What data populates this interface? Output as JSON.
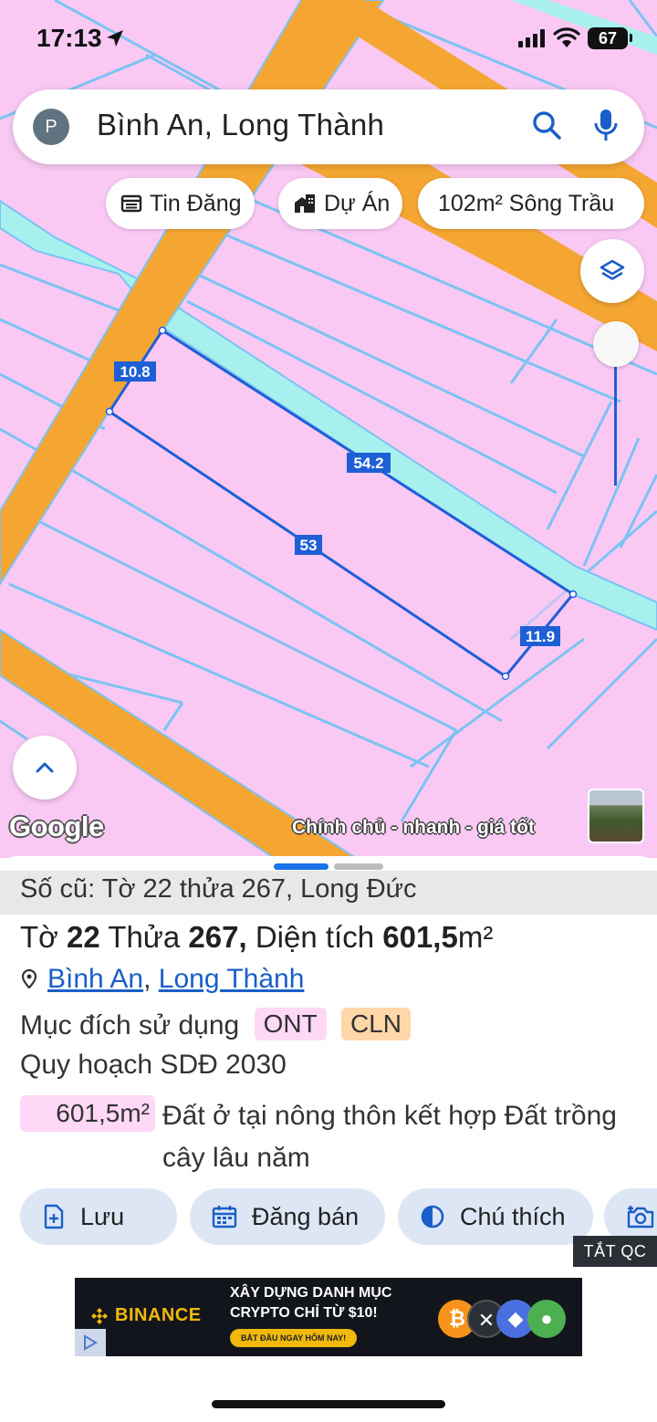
{
  "status_bar": {
    "time": "17:13",
    "battery": "67"
  },
  "search": {
    "avatar_letter": "P",
    "query": "Bình An, Long Thành"
  },
  "chips": [
    {
      "label": "Tin Đăng",
      "icon": "listing-icon"
    },
    {
      "label": "Dự Án",
      "icon": "building-icon"
    },
    {
      "label": "102m² Sông Trầu",
      "icon": ""
    }
  ],
  "map": {
    "edge_labels": {
      "top": "10.8",
      "right_top": "54.2",
      "bottom_long": "53",
      "right": "11.9"
    },
    "google_logo": "Google",
    "promo_text": "Chính chủ - nhanh - giá tốt"
  },
  "colors": {
    "land": "#f9c9f4",
    "road": "#f5a632",
    "water": "#a7f0ee",
    "parcel_line": "#7cc3f2",
    "selected": "#1e5fd6",
    "accent": "#1a73e8"
  },
  "sheet": {
    "old_info": "Số cũ: Tờ 22 thửa 267, Long Đức",
    "title": {
      "to_label": "Tờ",
      "to": "22",
      "thua_label": "Thửa",
      "thua": "267,",
      "area_label": "Diện tích",
      "area": "601,5",
      "unit": "m²"
    },
    "address": {
      "commune": "Bình An",
      "sep": ",",
      "district": "Long Thành"
    },
    "purpose": {
      "label": "Mục đích sử dụng",
      "tags": [
        "ONT",
        "CLN"
      ]
    },
    "plan": "Quy hoạch SDĐ 2030",
    "plan_area": "601,5m²",
    "plan_desc": "Đất ở tại nông thôn kết hợp Đất trồng cây lâu năm"
  },
  "actions": [
    {
      "label": "Lưu",
      "icon": "save-icon"
    },
    {
      "label": "Đăng bán",
      "icon": "calendar-icon"
    },
    {
      "label": "Chú thích",
      "icon": "legend-icon"
    },
    {
      "label": "",
      "icon": "camera-icon"
    }
  ],
  "ad": {
    "close_label": "TẮT QC",
    "brand": "BINANCE",
    "line1": "XÂY DỰNG DANH MỤC",
    "line2": "CRYPTO CHỈ TỪ $10!",
    "cta": "BẮT ĐẦU NGAY HÔM NAY!"
  }
}
